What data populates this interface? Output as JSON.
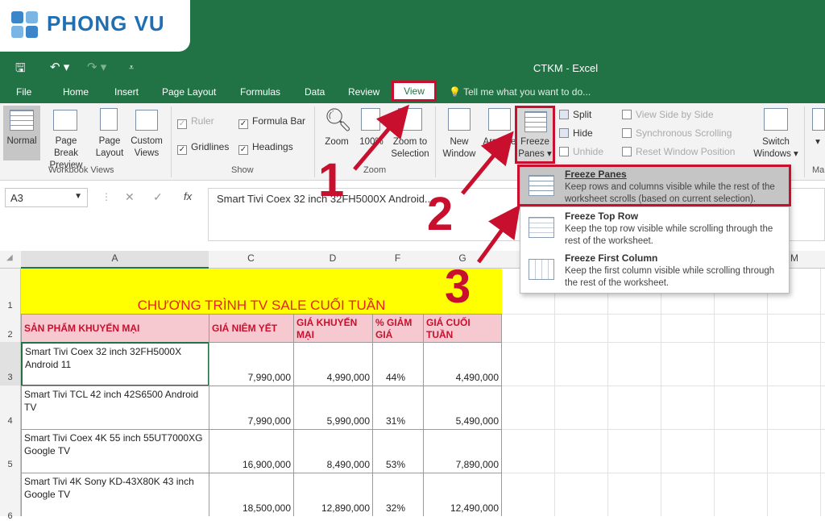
{
  "brand": {
    "logo_text": "PHONG VU",
    "logo_color": "#1f6fb2"
  },
  "window": {
    "title": "CTKM - Excel",
    "accent": "#217346"
  },
  "tabs": [
    "File",
    "Home",
    "Insert",
    "Page Layout",
    "Formulas",
    "Data",
    "Review",
    "View"
  ],
  "tell_me": "Tell me what you want to do...",
  "ribbon": {
    "workbook_views": {
      "label": "Workbook Views",
      "normal": "Normal",
      "page_break_1": "Page Break",
      "page_break_2": "Preview",
      "page_layout_1": "Page",
      "page_layout_2": "Layout",
      "custom_views_1": "Custom",
      "custom_views_2": "Views"
    },
    "show": {
      "label": "Show",
      "ruler": "Ruler",
      "formula_bar": "Formula Bar",
      "gridlines": "Gridlines",
      "headings": "Headings"
    },
    "zoom": {
      "label": "Zoom",
      "zoom": "Zoom",
      "hundred": "100%",
      "zoom_sel_1": "Zoom to",
      "zoom_sel_2": "Selection"
    },
    "window": {
      "new_1": "New",
      "new_2": "Window",
      "arrange_1": "Arrange",
      "arrange_2": "All",
      "freeze_1": "Freeze",
      "freeze_2": "Panes",
      "split": "Split",
      "hide": "Hide",
      "unhide": "Unhide",
      "side_by_side": "View Side by Side",
      "sync_scroll": "Synchronous Scrolling",
      "reset_pos": "Reset Window Position",
      "switch_1": "Switch",
      "switch_2": "Windows",
      "macro_label": "Ma"
    }
  },
  "formula_bar": {
    "name_box": "A3",
    "fx": "fx",
    "content": "Smart Tivi Coex 32 inch 32FH5000X Android..."
  },
  "columns": [
    "A",
    "C",
    "D",
    "F",
    "G",
    "M"
  ],
  "rows": [
    "1",
    "2",
    "3",
    "4",
    "5",
    "6"
  ],
  "sheet": {
    "banner": "CHƯƠNG TRÌNH TV SALE CUỐI TUẦN",
    "headers": [
      "SẢN PHẨM KHUYẾN MẠI",
      "GIÁ NIÊM YẾT",
      "GIÁ KHUYẾN MẠI",
      "% GIẢM GIÁ",
      "GIÁ CUỐI TUẦN"
    ],
    "data_rows": [
      {
        "product": "Smart Tivi Coex 32 inch 32FH5000X Android 11",
        "list": "7,990,000",
        "promo": "4,990,000",
        "pct": "44%",
        "final": "4,490,000"
      },
      {
        "product": "Smart Tivi TCL 42 inch 42S6500 Android TV",
        "list": "7,990,000",
        "promo": "5,990,000",
        "pct": "31%",
        "final": "5,490,000"
      },
      {
        "product": "Smart Tivi Coex 4K 55 inch 55UT7000XG Google TV",
        "list": "16,900,000",
        "promo": "8,490,000",
        "pct": "53%",
        "final": "7,890,000"
      },
      {
        "product": "Smart Tivi 4K Sony KD-43X80K 43 inch Google TV",
        "list": "18,500,000",
        "promo": "12,890,000",
        "pct": "32%",
        "final": "12,490,000"
      }
    ]
  },
  "freeze_menu": [
    {
      "title": "Freeze Panes",
      "desc": "Keep rows and columns visible while the rest of the worksheet scrolls (based on current selection)."
    },
    {
      "title": "Freeze Top Row",
      "desc": "Keep the top row visible while scrolling through the rest of the worksheet."
    },
    {
      "title": "Freeze First Column",
      "desc": "Keep the first column visible while scrolling through the rest of the worksheet."
    }
  ],
  "annotations": [
    "1",
    "2",
    "3"
  ]
}
